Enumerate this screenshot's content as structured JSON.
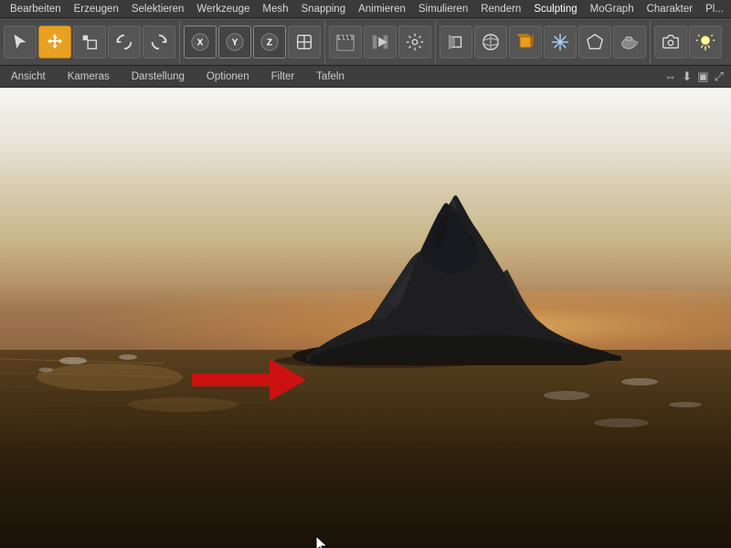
{
  "menubar": {
    "items": [
      {
        "id": "bearbeiten",
        "label": "Bearbeiten"
      },
      {
        "id": "erzeugen",
        "label": "Erzeugen"
      },
      {
        "id": "selektieren",
        "label": "Selektieren"
      },
      {
        "id": "werkzeuge",
        "label": "Werkzeuge"
      },
      {
        "id": "mesh",
        "label": "Mesh"
      },
      {
        "id": "snapping",
        "label": "Snapping"
      },
      {
        "id": "animieren",
        "label": "Animieren"
      },
      {
        "id": "simulieren",
        "label": "Simulieren"
      },
      {
        "id": "rendern",
        "label": "Rendern"
      },
      {
        "id": "sculpting",
        "label": "Sculpting"
      },
      {
        "id": "mograph",
        "label": "MoGraph"
      },
      {
        "id": "charakter",
        "label": "Charakter"
      },
      {
        "id": "plugins",
        "label": "Pl..."
      }
    ]
  },
  "viewport_toolbar": {
    "tabs": [
      {
        "id": "ansicht",
        "label": "Ansicht"
      },
      {
        "id": "kameras",
        "label": "Kameras"
      },
      {
        "id": "darstellung",
        "label": "Darstellung"
      },
      {
        "id": "optionen",
        "label": "Optionen"
      },
      {
        "id": "filter",
        "label": "Filter"
      },
      {
        "id": "tafeln",
        "label": "Tafeln"
      }
    ]
  },
  "colors": {
    "menu_bg": "#3a3a3a",
    "toolbar_bg": "#4a4a4a",
    "active_tool": "#e8a020",
    "text": "#d0d0d0",
    "arrow_red": "#cc1111"
  }
}
